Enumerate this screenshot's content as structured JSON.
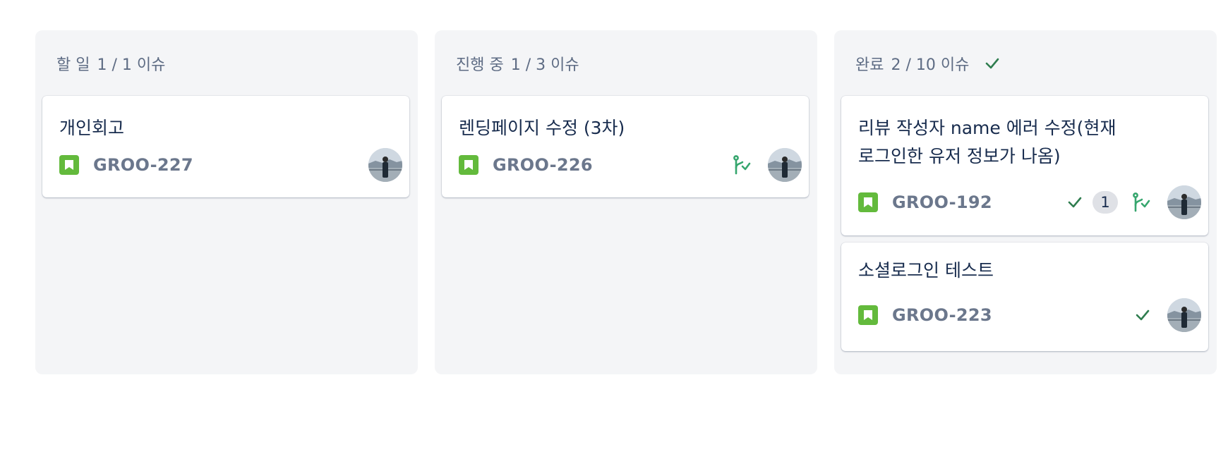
{
  "columns": [
    {
      "name": "할 일",
      "count": "1 / 1 이슈",
      "cards": [
        {
          "title": "개인회고",
          "key": "GROO-227"
        }
      ]
    },
    {
      "name": "진행 중",
      "count": "1 / 3 이슈",
      "cards": [
        {
          "title": "렌딩페이지 수정 (3차)",
          "key": "GROO-226",
          "icons": [
            "branch-check-icon"
          ]
        }
      ]
    },
    {
      "name": "완료",
      "count": "2 / 10 이슈",
      "header_icon": "check-icon",
      "cards": [
        {
          "title_lines": [
            "리뷰 작성자 name 에러 수정(현재",
            "로그인한 유저 정보가 나옴)"
          ],
          "key": "GROO-192",
          "icons": [
            "check-icon",
            "branch-check-icon"
          ],
          "badge": "1"
        },
        {
          "title": "소셜로그인 테스트",
          "key": "GROO-223",
          "icons": [
            "check-icon"
          ]
        }
      ]
    }
  ],
  "colors": {
    "column_bg": "#f4f5f7",
    "story_icon": "#63ba3c",
    "done_green": "#2f7d4f",
    "dev_green": "#36a66e",
    "key_gray": "#6b778c"
  }
}
